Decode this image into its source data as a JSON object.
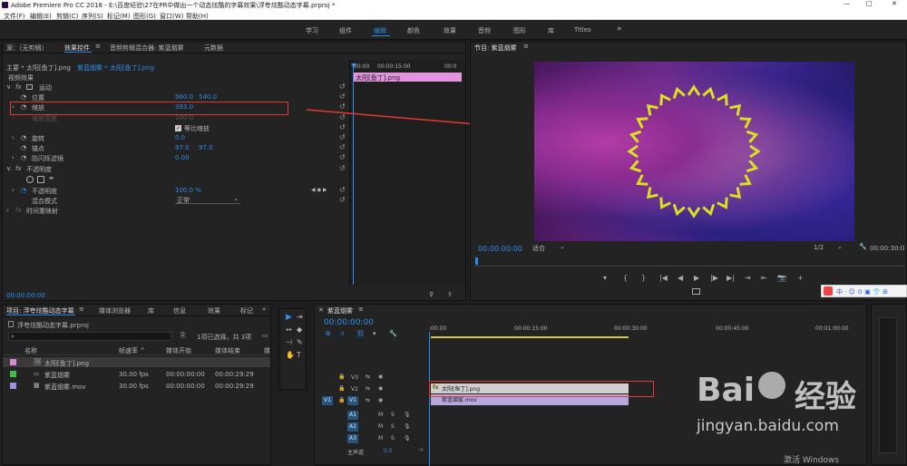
{
  "titlebar": {
    "title": "Adobe Premiere Pro CC 2018 - E:\\百度经验\\27在PR中做出一个动态炫酷的字幕效果\\浮夸炫酷动态字幕.prproj *",
    "min": "—",
    "max": "□",
    "close": "✕"
  },
  "menu": [
    "文件(F)",
    "编辑(E)",
    "剪辑(C)",
    "序列(S)",
    "标记(M)",
    "图形(G)",
    "窗口(W)",
    "帮助(H)"
  ],
  "workspaces": [
    "学习",
    "组件",
    "编辑",
    "颜色",
    "效果",
    "音频",
    "图形",
    "库",
    "Titles"
  ],
  "workspace_active": "编辑",
  "ws_more": "»",
  "effect_panel": {
    "tabs": [
      "源：（无剪辑）",
      "效果控件",
      "音频剪辑混合器: 紫蓝烟雾",
      "元数据"
    ],
    "menu_icon": "≡",
    "clip_master": "主要 * 太阳[鱼丁].png",
    "clip_seq": "紫蓝烟雾 * 太阳[鱼丁].png",
    "ruler": [
      "00:00",
      "00:00:15:00",
      "00:0"
    ],
    "clip_bar": "太阳[鱼丁].png",
    "section_video": "视频效果",
    "fx_motion": "fx",
    "motion": "运动",
    "position_label": "位置",
    "position_x": "960.0",
    "position_y": "540.0",
    "scale_label": "缩放",
    "scale_val": "393.0",
    "scale_w_label": "缩放宽度",
    "scale_w_val": "100.0",
    "uniform": "等比缩放",
    "rotation_label": "旋转",
    "rotation_val": "0.0",
    "anchor_label": "锚点",
    "anchor_x": "97.0",
    "anchor_y": "97.0",
    "flicker_label": "防闪烁滤镜",
    "flicker_val": "0.00",
    "opacity_section": "不透明度",
    "opacity_label": "不透明度",
    "opacity_val": "100.0 %",
    "blend_label": "混合模式",
    "blend_val": "正常",
    "time_remap": "时间重映射",
    "timecode": "00:00:00:00",
    "keyframe_nav": "◀ ◆ ▶"
  },
  "program": {
    "title": "节目: 紫蓝烟雾",
    "menu_icon": "≡",
    "timecode": "00:00:00:00",
    "fit": "适合",
    "quality": "1/2",
    "end_timecode": "00:00:30:0",
    "controls": [
      "▾",
      "{",
      "}",
      "|◀",
      "◀|",
      "◀",
      "▶",
      "|▶",
      "▶|",
      "⇥",
      "⇤",
      "⊞",
      "📷",
      "+"
    ]
  },
  "project": {
    "tabs": [
      "项目: 浮夸炫酷动态字幕",
      "媒体浏览器",
      "库",
      "信息",
      "效果",
      "标记"
    ],
    "more": "»",
    "filename": "浮夸炫酷动态字幕.prproj",
    "search_placeholder": "",
    "selection": "1项已选择，共 3项",
    "cols": [
      "名称",
      "帧速率 ^",
      "媒体开始",
      "媒体结束",
      "媒"
    ],
    "rows": [
      {
        "color": "#d98ad6",
        "name": "太阳[鱼丁].png",
        "fps": "",
        "start": "",
        "end": ""
      },
      {
        "color": "#3fbf4a",
        "name": "紫蓝烟雾",
        "fps": "30.00 fps",
        "start": "00:00:00:00",
        "end": "00:00:29:29"
      },
      {
        "color": "#a38fe0",
        "name": "紫蓝烟雾.mov",
        "fps": "30.00 fps",
        "start": "00:00:00:00",
        "end": "00:00:29:29"
      }
    ]
  },
  "timeline": {
    "title": "紫蓝烟雾",
    "menu_icon": "≡",
    "timecode": "00:00:00:00",
    "ruler": [
      ":00:00",
      "00:00:15:00",
      "00:00:30:00",
      "00:00:45:00",
      "00:01:00:00"
    ],
    "tracks": [
      "V3",
      "V2",
      "V1",
      "A1",
      "A2",
      "A3"
    ],
    "source_patch": "V1",
    "master": "主声道",
    "master_val": "0.0",
    "clip_v2": "太阳[鱼丁].png",
    "clip_v1": "紫蓝烟雾.mov"
  },
  "tools": [
    "▶",
    "⊕",
    "↔",
    "⊣",
    "✎",
    "✋",
    "T"
  ],
  "watermark": {
    "baidu_a": "Bai",
    "baidu_b": "经验",
    "url": "jingyan.baidu.com",
    "win": "激活 Windows",
    "tray": "中 · ☺ ⊙ ▣ 👕 ⊞"
  },
  "colors": {
    "accent": "#2d8ceb",
    "clip_pink": "#e295de",
    "clip_v1": "#b8a8e0",
    "annotation": "#e53935"
  }
}
